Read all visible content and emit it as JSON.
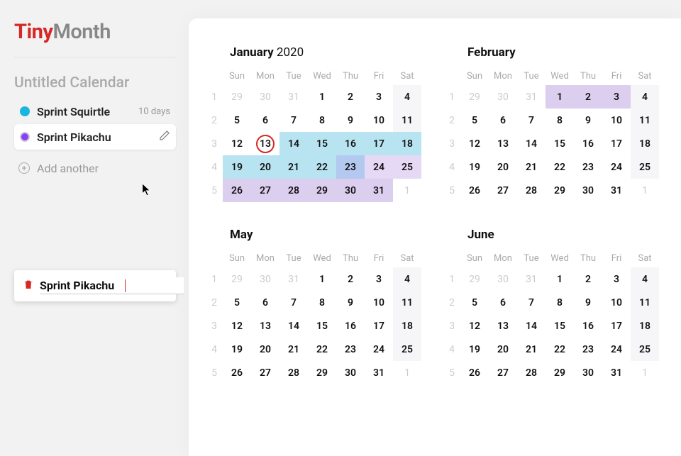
{
  "logo": {
    "a": "Tiny",
    "b": "Month"
  },
  "calendar_title": "Untitled Calendar",
  "sprints": [
    {
      "label": "Sprint Squirtle",
      "days": "10 days",
      "color": "cyan"
    },
    {
      "label": "Sprint Pikachu",
      "days": "",
      "color": "purple"
    }
  ],
  "add_label": "Add another",
  "edit": {
    "value": "Sprint Pikachu"
  },
  "day_headers": [
    "Sun",
    "Mon",
    "Tue",
    "Wed",
    "Thu",
    "Fri",
    "Sat"
  ],
  "months": {
    "jan": {
      "name": "January",
      "year": "2020",
      "weeks": [
        {
          "wn": "1",
          "d": [
            {
              "n": "29",
              "c": "dim"
            },
            {
              "n": "30",
              "c": "dim"
            },
            {
              "n": "31",
              "c": "dim"
            },
            {
              "n": "1"
            },
            {
              "n": "2"
            },
            {
              "n": "3"
            },
            {
              "n": "4",
              "c": "sat"
            }
          ]
        },
        {
          "wn": "2",
          "d": [
            {
              "n": "5"
            },
            {
              "n": "6"
            },
            {
              "n": "7"
            },
            {
              "n": "8"
            },
            {
              "n": "9"
            },
            {
              "n": "10"
            },
            {
              "n": "11",
              "c": "sat"
            }
          ]
        },
        {
          "wn": "3",
          "d": [
            {
              "n": "12"
            },
            {
              "n": "13",
              "c": "today"
            },
            {
              "n": "14",
              "c": "hl-cy"
            },
            {
              "n": "15",
              "c": "hl-cy"
            },
            {
              "n": "16",
              "c": "hl-cy"
            },
            {
              "n": "17",
              "c": "hl-cy"
            },
            {
              "n": "18",
              "c": "hl-cy"
            }
          ]
        },
        {
          "wn": "4",
          "d": [
            {
              "n": "19",
              "c": "hl-cy"
            },
            {
              "n": "20",
              "c": "hl-cy"
            },
            {
              "n": "21",
              "c": "hl-cy"
            },
            {
              "n": "22",
              "c": "hl-cy"
            },
            {
              "n": "23",
              "c": "sel"
            },
            {
              "n": "24",
              "c": "hl-pu-lt"
            },
            {
              "n": "25",
              "c": "hl-pu-lt"
            }
          ]
        },
        {
          "wn": "5",
          "d": [
            {
              "n": "26",
              "c": "hl-pu"
            },
            {
              "n": "27",
              "c": "hl-pu"
            },
            {
              "n": "28",
              "c": "hl-pu"
            },
            {
              "n": "29",
              "c": "hl-pu"
            },
            {
              "n": "30",
              "c": "hl-pu"
            },
            {
              "n": "31",
              "c": "hl-pu"
            },
            {
              "n": "1",
              "c": "dim"
            }
          ]
        }
      ]
    },
    "feb": {
      "name": "February",
      "year": "",
      "weeks": [
        {
          "wn": "1",
          "d": [
            {
              "n": "29",
              "c": "dim"
            },
            {
              "n": "30",
              "c": "dim"
            },
            {
              "n": "31",
              "c": "dim"
            },
            {
              "n": "1",
              "c": "hl-pu"
            },
            {
              "n": "2",
              "c": "hl-pu"
            },
            {
              "n": "3",
              "c": "hl-pu"
            },
            {
              "n": "4",
              "c": "sat"
            }
          ]
        },
        {
          "wn": "2",
          "d": [
            {
              "n": "5"
            },
            {
              "n": "6"
            },
            {
              "n": "7"
            },
            {
              "n": "8"
            },
            {
              "n": "9"
            },
            {
              "n": "10"
            },
            {
              "n": "11",
              "c": "sat"
            }
          ]
        },
        {
          "wn": "3",
          "d": [
            {
              "n": "12"
            },
            {
              "n": "13"
            },
            {
              "n": "14"
            },
            {
              "n": "15"
            },
            {
              "n": "16"
            },
            {
              "n": "17"
            },
            {
              "n": "18",
              "c": "sat"
            }
          ]
        },
        {
          "wn": "4",
          "d": [
            {
              "n": "19"
            },
            {
              "n": "20"
            },
            {
              "n": "21"
            },
            {
              "n": "22"
            },
            {
              "n": "23"
            },
            {
              "n": "24"
            },
            {
              "n": "25",
              "c": "sat"
            }
          ]
        },
        {
          "wn": "5",
          "d": [
            {
              "n": "26"
            },
            {
              "n": "27"
            },
            {
              "n": "28"
            },
            {
              "n": "29"
            },
            {
              "n": "30"
            },
            {
              "n": "31"
            },
            {
              "n": "1",
              "c": "dim"
            }
          ]
        }
      ]
    },
    "may": {
      "name": "May",
      "year": "",
      "weeks": [
        {
          "wn": "1",
          "d": [
            {
              "n": "29",
              "c": "dim"
            },
            {
              "n": "30",
              "c": "dim"
            },
            {
              "n": "31",
              "c": "dim"
            },
            {
              "n": "1"
            },
            {
              "n": "2"
            },
            {
              "n": "3"
            },
            {
              "n": "4",
              "c": "sat"
            }
          ]
        },
        {
          "wn": "2",
          "d": [
            {
              "n": "5"
            },
            {
              "n": "6"
            },
            {
              "n": "7"
            },
            {
              "n": "8"
            },
            {
              "n": "9"
            },
            {
              "n": "10"
            },
            {
              "n": "11",
              "c": "sat"
            }
          ]
        },
        {
          "wn": "3",
          "d": [
            {
              "n": "12"
            },
            {
              "n": "13"
            },
            {
              "n": "14"
            },
            {
              "n": "15"
            },
            {
              "n": "16"
            },
            {
              "n": "17"
            },
            {
              "n": "18",
              "c": "sat"
            }
          ]
        },
        {
          "wn": "4",
          "d": [
            {
              "n": "19"
            },
            {
              "n": "20"
            },
            {
              "n": "21"
            },
            {
              "n": "22"
            },
            {
              "n": "23"
            },
            {
              "n": "24"
            },
            {
              "n": "25",
              "c": "sat"
            }
          ]
        },
        {
          "wn": "5",
          "d": [
            {
              "n": "26"
            },
            {
              "n": "27"
            },
            {
              "n": "28"
            },
            {
              "n": "29"
            },
            {
              "n": "30"
            },
            {
              "n": "31"
            },
            {
              "n": "1",
              "c": "dim"
            }
          ]
        }
      ]
    },
    "jun": {
      "name": "June",
      "year": "",
      "weeks": [
        {
          "wn": "1",
          "d": [
            {
              "n": "29",
              "c": "dim"
            },
            {
              "n": "30",
              "c": "dim"
            },
            {
              "n": "31",
              "c": "dim"
            },
            {
              "n": "1"
            },
            {
              "n": "2"
            },
            {
              "n": "3"
            },
            {
              "n": "4",
              "c": "sat"
            }
          ]
        },
        {
          "wn": "2",
          "d": [
            {
              "n": "5"
            },
            {
              "n": "6"
            },
            {
              "n": "7"
            },
            {
              "n": "8"
            },
            {
              "n": "9"
            },
            {
              "n": "10"
            },
            {
              "n": "11",
              "c": "sat"
            }
          ]
        },
        {
          "wn": "3",
          "d": [
            {
              "n": "12"
            },
            {
              "n": "13"
            },
            {
              "n": "14"
            },
            {
              "n": "15"
            },
            {
              "n": "16"
            },
            {
              "n": "17"
            },
            {
              "n": "18",
              "c": "sat"
            }
          ]
        },
        {
          "wn": "4",
          "d": [
            {
              "n": "19"
            },
            {
              "n": "20"
            },
            {
              "n": "21"
            },
            {
              "n": "22"
            },
            {
              "n": "23"
            },
            {
              "n": "24"
            },
            {
              "n": "25",
              "c": "sat"
            }
          ]
        },
        {
          "wn": "5",
          "d": [
            {
              "n": "26"
            },
            {
              "n": "27"
            },
            {
              "n": "28"
            },
            {
              "n": "29"
            },
            {
              "n": "30"
            },
            {
              "n": "31"
            },
            {
              "n": "1",
              "c": "dim"
            }
          ]
        }
      ]
    }
  }
}
